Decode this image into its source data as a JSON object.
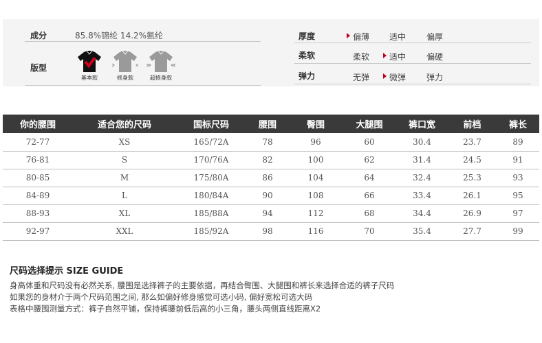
{
  "attributes": {
    "composition": {
      "label": "成分",
      "value": "85.8%锦纶 14.2%氨纶"
    },
    "fit": {
      "label": "版型",
      "options": [
        {
          "caption": "基本款",
          "selected": true
        },
        {
          "caption": "修身款",
          "selected": false
        },
        {
          "caption": "超修身款",
          "selected": false
        }
      ]
    },
    "thickness": {
      "label": "厚度",
      "options": [
        "偏薄",
        "适中",
        "偏厚"
      ],
      "selected_index": 0
    },
    "softness": {
      "label": "柔软",
      "options": [
        "柔软",
        "适中",
        "偏硬"
      ],
      "selected_index": 1
    },
    "elasticity": {
      "label": "弹力",
      "options": [
        "无弹",
        "微弹",
        "弹力"
      ],
      "selected_index": 1
    }
  },
  "size_table": {
    "headers": [
      "你的腰围",
      "适合您的尺码",
      "国标尺码",
      "腰围",
      "臀围",
      "大腿围",
      "裤口宽",
      "前档",
      "裤长"
    ],
    "rows": [
      [
        "72-77",
        "XS",
        "165/72A",
        "78",
        "96",
        "60",
        "30.4",
        "23.7",
        "89"
      ],
      [
        "76-81",
        "S",
        "170/76A",
        "82",
        "100",
        "62",
        "31.4",
        "24.5",
        "91"
      ],
      [
        "80-85",
        "M",
        "175/80A",
        "86",
        "104",
        "64",
        "32.4",
        "25.3",
        "93"
      ],
      [
        "84-89",
        "L",
        "180/84A",
        "90",
        "108",
        "66",
        "33.4",
        "26.1",
        "95"
      ],
      [
        "88-93",
        "XL",
        "185/88A",
        "94",
        "112",
        "68",
        "34.4",
        "26.9",
        "97"
      ],
      [
        "92-97",
        "XXL",
        "185/92A",
        "98",
        "116",
        "70",
        "35.4",
        "27.7",
        "99"
      ]
    ]
  },
  "guide": {
    "title": "尺码选择提示 SIZE GUIDE",
    "lines": [
      "身高体重和尺码没有必然关系, 腰围是选择裤子的主要依据，再结合臀围、大腿围和裤长来选择合适的裤子尺码",
      "如果您的身材介于两个尺码范围之间, 那么如偏好修身感觉可选小码, 偏好宽松可选大码",
      "表格中腰围测量方式：裤子自然平铺，保持裤腰前低后高的小三角，腰头两侧直线距离X2"
    ]
  },
  "colors": {
    "header_bg": "#3a3a3a",
    "panel_bg": "#f4f4f4",
    "marker": "#c0001a",
    "check": "#d2001e"
  },
  "icons": [
    "shirt-icon",
    "checkmark-icon",
    "arrow-right-icon"
  ]
}
